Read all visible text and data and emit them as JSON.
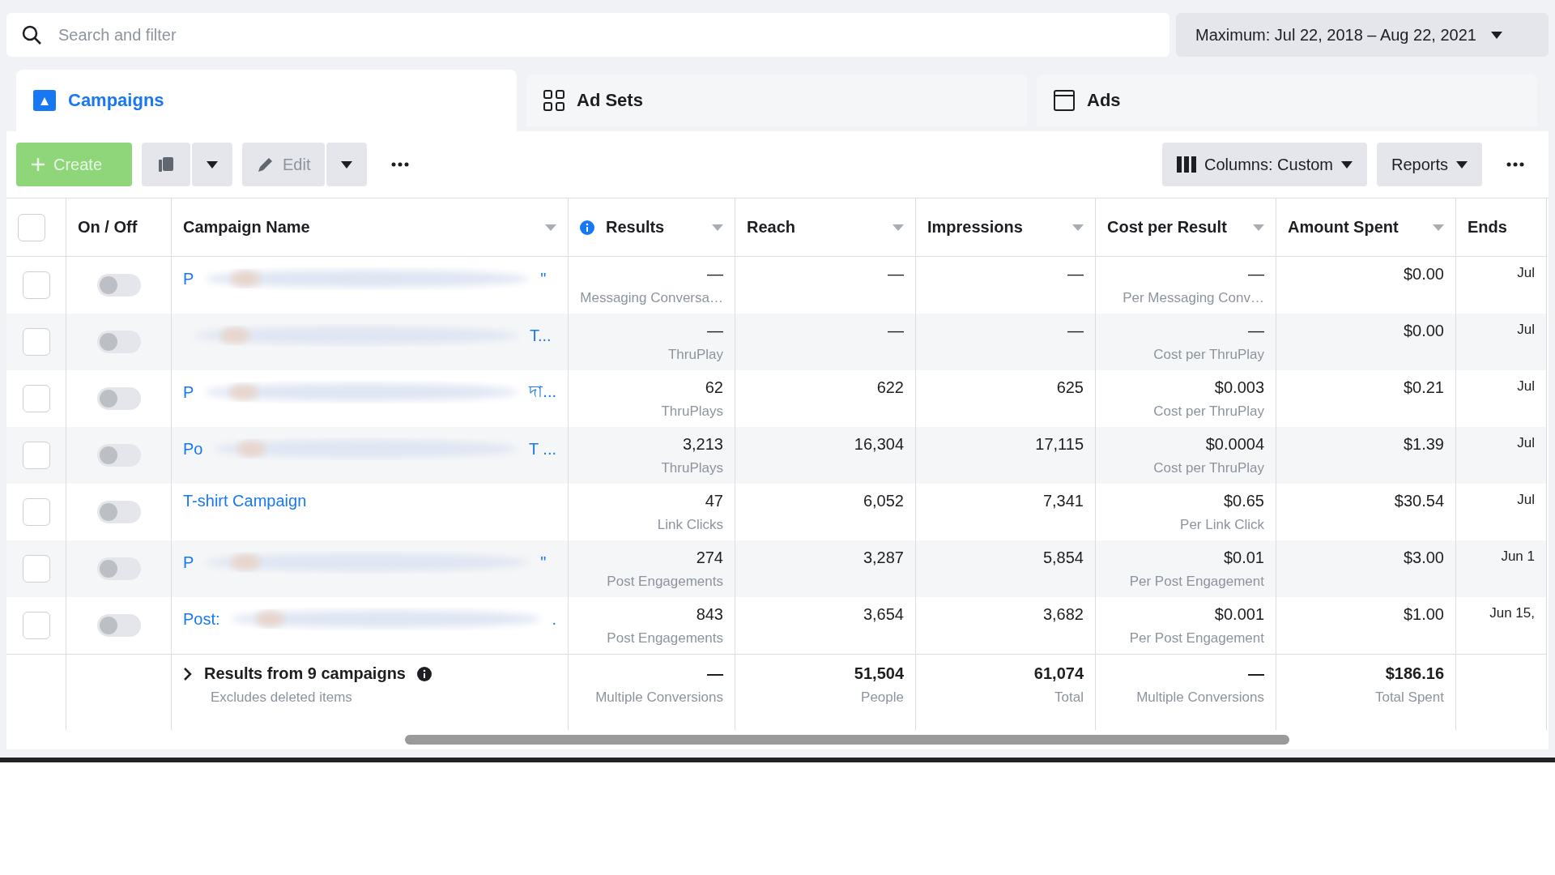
{
  "search": {
    "placeholder": "Search and filter"
  },
  "date_range": "Maximum: Jul 22, 2018 – Aug 22, 2021",
  "tabs": [
    {
      "label": "Campaigns",
      "kind": "campaigns",
      "selected": true
    },
    {
      "label": "Ad Sets",
      "kind": "adsets",
      "selected": false
    },
    {
      "label": "Ads",
      "kind": "ads",
      "selected": false
    }
  ],
  "toolbar": {
    "create": "Create",
    "edit": "Edit",
    "columns": "Columns: Custom",
    "reports": "Reports"
  },
  "table": {
    "select_all": false,
    "columns": [
      "On / Off",
      "Campaign Name",
      "Results",
      "Reach",
      "Impressions",
      "Cost per Result",
      "Amount Spent",
      "Ends"
    ],
    "rows": [
      {
        "checked": false,
        "on": false,
        "name_start": "P",
        "name_end": "\"",
        "blurred": true,
        "results": "—",
        "results_sub": "Messaging Conversa…",
        "reach": "—",
        "impressions": "—",
        "cost": "—",
        "cost_sub": "Per Messaging Conv…",
        "spent": "$0.00",
        "ends": "Jul"
      },
      {
        "checked": false,
        "on": false,
        "name_end": "T...",
        "blurred": true,
        "results": "—",
        "results_sub": "ThruPlay",
        "reach": "—",
        "impressions": "—",
        "cost": "—",
        "cost_sub": "Cost per ThruPlay",
        "spent": "$0.00",
        "ends": "Jul"
      },
      {
        "checked": false,
        "on": false,
        "name_start": "P",
        "name_end": "দা...",
        "blurred": true,
        "results": "62",
        "results_sub": "ThruPlays",
        "reach": "622",
        "impressions": "625",
        "cost": "$0.003",
        "cost_sub": "Cost per ThruPlay",
        "spent": "$0.21",
        "ends": "Jul"
      },
      {
        "checked": false,
        "on": false,
        "name_start": "Po",
        "name_end": "T ...",
        "blurred": true,
        "results": "3,213",
        "results_sub": "ThruPlays",
        "reach": "16,304",
        "impressions": "17,115",
        "cost": "$0.0004",
        "cost_sub": "Cost per ThruPlay",
        "spent": "$1.39",
        "ends": "Jul"
      },
      {
        "checked": false,
        "on": false,
        "name_start": "T-shirt Campaign",
        "blurred": false,
        "results": "47",
        "results_sub": "Link Clicks",
        "reach": "6,052",
        "impressions": "7,341",
        "cost": "$0.65",
        "cost_sub": "Per Link Click",
        "spent": "$30.54",
        "ends": "Jul"
      },
      {
        "checked": false,
        "on": false,
        "name_start": "P",
        "name_end": "\"",
        "blurred": true,
        "results": "274",
        "results_sub": "Post Engagements",
        "reach": "3,287",
        "impressions": "5,854",
        "cost": "$0.01",
        "cost_sub": "Per Post Engagement",
        "spent": "$3.00",
        "ends": "Jun 1"
      },
      {
        "checked": false,
        "on": false,
        "name_start": "Post:",
        "name_end": ".",
        "blurred": true,
        "results": "843",
        "results_sub": "Post Engagements",
        "reach": "3,654",
        "impressions": "3,682",
        "cost": "$0.001",
        "cost_sub": "Per Post Engagement",
        "spent": "$1.00",
        "ends": "Jun 15,"
      }
    ],
    "summary": {
      "title": "Results from 9 campaigns",
      "note": "Excludes deleted items",
      "results": "—",
      "results_sub": "Multiple Conversions",
      "reach": "51,504",
      "reach_sub": "People",
      "impressions": "61,074",
      "impressions_sub": "Total",
      "cost": "—",
      "cost_sub": "Multiple Conversions",
      "spent": "$186.16",
      "spent_sub": "Total Spent"
    }
  }
}
